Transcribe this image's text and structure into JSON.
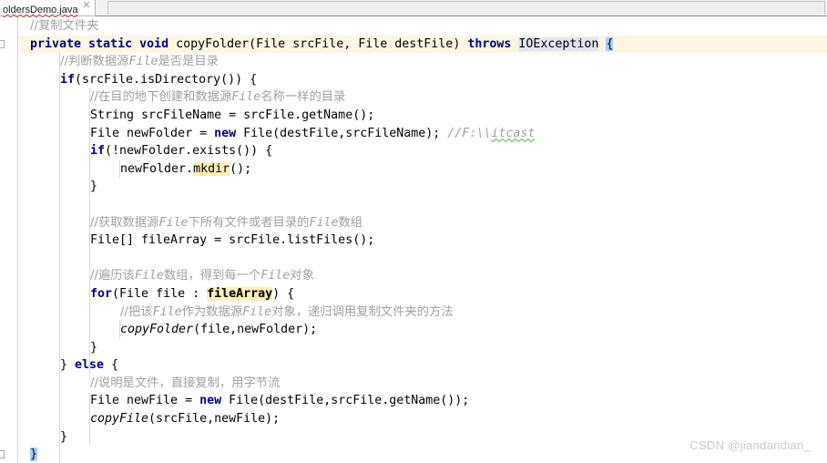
{
  "window": {
    "tab": {
      "label": "oldersDemo.java",
      "close_icon": "close-icon",
      "has_error_underline": true
    }
  },
  "editor": {
    "language": "java",
    "colors": {
      "keyword": "#000080",
      "comment": "#a0a0a0",
      "current_line_bg": "#fdf6e3",
      "search_highlight_bg": "#ffeeba",
      "brace_match_bg": "#a3cfff",
      "exception_bg": "#e4e4f7",
      "text": "#000000"
    },
    "search_term": "fileArray",
    "lines": [
      {
        "indent": 0,
        "parts": [
          {
            "t": "//复制文件夹",
            "c": "cmt-cjk"
          }
        ]
      },
      {
        "indent": 0,
        "highlight": true,
        "fold": true,
        "parts": [
          {
            "t": "private static void ",
            "c": "kw"
          },
          {
            "t": "copyFolder(File srcFile, File destFile) ",
            "c": "plain"
          },
          {
            "t": "throws ",
            "c": "kw"
          },
          {
            "t": "IOException",
            "c": "exc"
          },
          {
            "t": " ",
            "c": "plain"
          },
          {
            "t": "{",
            "c": "brace-hl"
          }
        ]
      },
      {
        "indent": 1,
        "parts": [
          {
            "t": "//判断数据源",
            "c": "cmt-cjk"
          },
          {
            "t": "File",
            "c": "cmt"
          },
          {
            "t": "是否是目录",
            "c": "cmt-cjk"
          }
        ]
      },
      {
        "indent": 1,
        "parts": [
          {
            "t": "if",
            "c": "kw"
          },
          {
            "t": "(srcFile.isDirectory()) {",
            "c": "plain"
          }
        ]
      },
      {
        "indent": 2,
        "parts": [
          {
            "t": "//在目的地下创建和数据源",
            "c": "cmt-cjk"
          },
          {
            "t": "File",
            "c": "cmt"
          },
          {
            "t": "名称一样的目录",
            "c": "cmt-cjk"
          }
        ]
      },
      {
        "indent": 2,
        "parts": [
          {
            "t": "String srcFileName = srcFile.getName();",
            "c": "plain"
          }
        ]
      },
      {
        "indent": 2,
        "parts": [
          {
            "t": "File newFolder = ",
            "c": "plain"
          },
          {
            "t": "new",
            "c": "kw"
          },
          {
            "t": " File(destFile,srcFileName); ",
            "c": "plain"
          },
          {
            "t": "//F:\\\\",
            "c": "cmt"
          },
          {
            "t": "itcast",
            "c": "cmt wavy-green"
          }
        ]
      },
      {
        "indent": 2,
        "parts": [
          {
            "t": "if",
            "c": "kw"
          },
          {
            "t": "(!newFolder.exists()) {",
            "c": "plain"
          }
        ]
      },
      {
        "indent": 3,
        "parts": [
          {
            "t": "newFolder.",
            "c": "plain"
          },
          {
            "t": "mkdir",
            "c": "find-hl"
          },
          {
            "t": "();",
            "c": "plain"
          }
        ]
      },
      {
        "indent": 2,
        "parts": [
          {
            "t": "}",
            "c": "plain"
          }
        ]
      },
      {
        "indent": 0,
        "parts": []
      },
      {
        "indent": 2,
        "parts": [
          {
            "t": "//获取数据源",
            "c": "cmt-cjk"
          },
          {
            "t": "File",
            "c": "cmt"
          },
          {
            "t": "下所有文件或者目录的",
            "c": "cmt-cjk"
          },
          {
            "t": "File",
            "c": "cmt"
          },
          {
            "t": "数组",
            "c": "cmt-cjk"
          }
        ]
      },
      {
        "indent": 2,
        "parts": [
          {
            "t": "File[] fileArray = srcFile.listFiles();",
            "c": "plain"
          }
        ]
      },
      {
        "indent": 0,
        "parts": []
      },
      {
        "indent": 2,
        "parts": [
          {
            "t": "//遍历该",
            "c": "cmt-cjk"
          },
          {
            "t": "File",
            "c": "cmt"
          },
          {
            "t": "数组，得到每一个",
            "c": "cmt-cjk"
          },
          {
            "t": "File",
            "c": "cmt"
          },
          {
            "t": "对象",
            "c": "cmt-cjk"
          }
        ]
      },
      {
        "indent": 2,
        "parts": [
          {
            "t": "for",
            "c": "kw"
          },
          {
            "t": "(File file : ",
            "c": "plain"
          },
          {
            "t": "fileArray",
            "c": "find-hl-b"
          },
          {
            "t": ") {",
            "c": "plain"
          }
        ]
      },
      {
        "indent": 3,
        "parts": [
          {
            "t": "//把该",
            "c": "cmt-cjk"
          },
          {
            "t": "File",
            "c": "cmt"
          },
          {
            "t": "作为数据源",
            "c": "cmt-cjk"
          },
          {
            "t": "File",
            "c": "cmt"
          },
          {
            "t": "对象，递归调用复制文件夹的方法",
            "c": "cmt-cjk"
          }
        ]
      },
      {
        "indent": 3,
        "parts": [
          {
            "t": "copyFolder",
            "c": "ital"
          },
          {
            "t": "(file,newFolder);",
            "c": "plain"
          }
        ]
      },
      {
        "indent": 2,
        "parts": [
          {
            "t": "}",
            "c": "plain"
          }
        ]
      },
      {
        "indent": 1,
        "parts": [
          {
            "t": "} ",
            "c": "plain"
          },
          {
            "t": "else",
            "c": "kw"
          },
          {
            "t": " {",
            "c": "plain"
          }
        ]
      },
      {
        "indent": 2,
        "parts": [
          {
            "t": "//说明是文件，直接复制，用字节流",
            "c": "cmt-cjk"
          }
        ]
      },
      {
        "indent": 2,
        "parts": [
          {
            "t": "File newFile = ",
            "c": "plain"
          },
          {
            "t": "new",
            "c": "kw"
          },
          {
            "t": " File(destFile,srcFile.getName());",
            "c": "plain"
          }
        ]
      },
      {
        "indent": 2,
        "parts": [
          {
            "t": "copyFile",
            "c": "ital"
          },
          {
            "t": "(srcFile,newFile);",
            "c": "plain"
          }
        ]
      },
      {
        "indent": 1,
        "parts": [
          {
            "t": "}",
            "c": "plain"
          }
        ]
      },
      {
        "indent": 0,
        "fold": true,
        "parts": [
          {
            "t": "}",
            "c": "brace-hl"
          }
        ]
      }
    ]
  },
  "watermark": {
    "text": "CSDN @jiandandian_"
  }
}
